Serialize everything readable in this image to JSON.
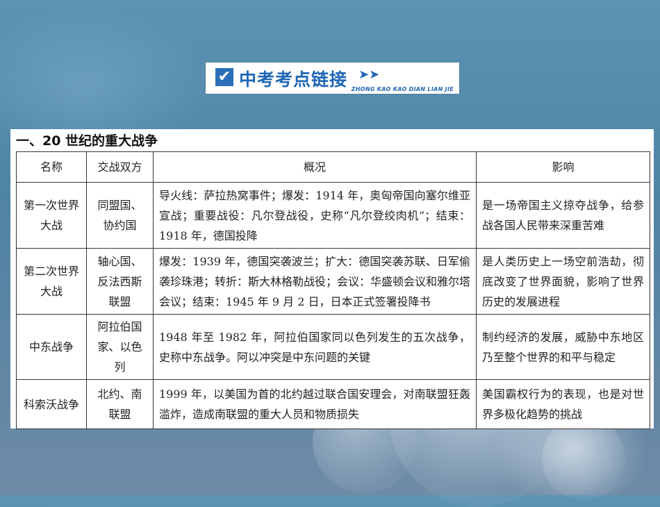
{
  "banner": {
    "icon": "check-box-icon",
    "title": "中考考点链接",
    "arrows": "➤➤",
    "pinyin": "ZHONG KAO KAO DIAN LIAN JIE"
  },
  "section": {
    "title": "一、20 世纪的重大战争"
  },
  "table": {
    "headers": [
      "名称",
      "交战双方",
      "概况",
      "影响"
    ],
    "rows": [
      {
        "name": "第一次世界大战",
        "sides": "同盟国、协约国",
        "overview": "导火线：萨拉热窝事件；爆发：1914 年，奥匈帝国向塞尔维亚宣战；重要战役：凡尔登战役，史称“凡尔登绞肉机”；结束：1918 年，德国投降",
        "impact": "是一场帝国主义掠夺战争，给参战各国人民带来深重苦难"
      },
      {
        "name": "第二次世界大战",
        "sides": "轴心国、反法西斯联盟",
        "overview": "爆发：1939 年，德国突袭波兰；扩大：德国突袭苏联、日军偷袭珍珠港；转折：斯大林格勒战役；会议：华盛顿会议和雅尔塔会议；结束：1945 年 9 月 2 日，日本正式签署投降书",
        "impact": "是人类历史上一场空前浩劫，彻底改变了世界面貌，影响了世界历史的发展进程"
      },
      {
        "name": "中东战争",
        "sides": "阿拉伯国家、以色列",
        "overview": "1948 年至 1982 年，阿拉伯国家同以色列发生的五次战争，史称中东战争。阿以冲突是中东问题的关键",
        "impact": "制约经济的发展，威胁中东地区乃至整个世界的和平与稳定"
      },
      {
        "name": "科索沃战争",
        "sides": "北约、南联盟",
        "overview": "1999 年，以美国为首的北约越过联合国安理会，对南联盟狂轰滥炸，造成南联盟的重大人员和物质损失",
        "impact": "美国霸权行为的表现，也是对世界多极化趋势的挑战"
      }
    ]
  }
}
